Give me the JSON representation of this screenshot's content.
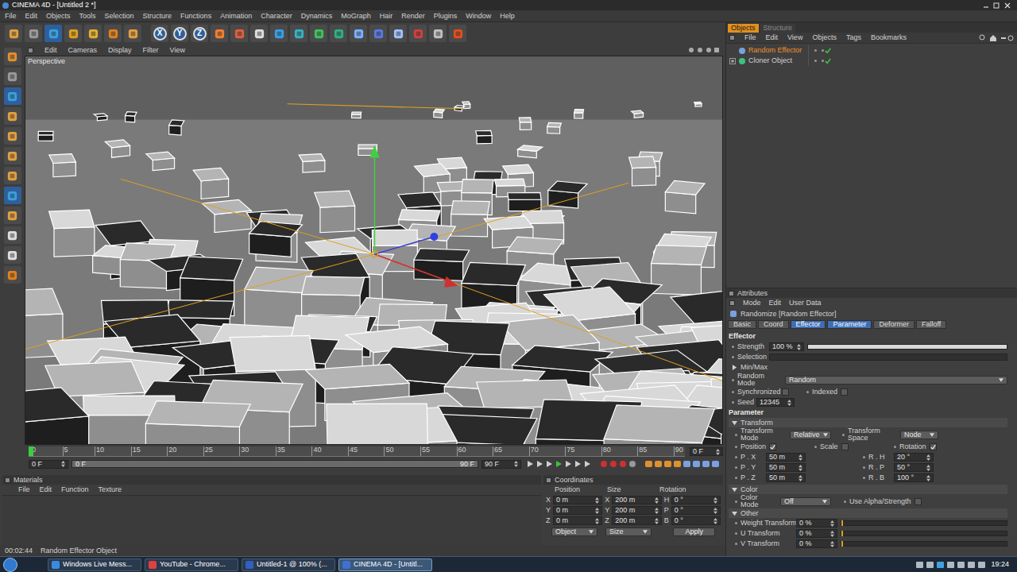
{
  "window": {
    "title": "CINEMA 4D - [Untitled 2 *]"
  },
  "menu": [
    "File",
    "Edit",
    "Objects",
    "Tools",
    "Selection",
    "Structure",
    "Functions",
    "Animation",
    "Character",
    "Dynamics",
    "MoGraph",
    "Hair",
    "Render",
    "Plugins",
    "Window",
    "Help"
  ],
  "toolbar": {
    "axis_buttons": [
      "X",
      "Y",
      "Z"
    ]
  },
  "viewport": {
    "menu": [
      "Edit",
      "Cameras",
      "Display",
      "Filter",
      "View"
    ],
    "label": "Perspective"
  },
  "timeline": {
    "ticks": [
      "0",
      "5",
      "10",
      "15",
      "20",
      "25",
      "30",
      "35",
      "40",
      "45",
      "50",
      "55",
      "60",
      "65",
      "70",
      "75",
      "80",
      "85",
      "90"
    ],
    "playhead": 0,
    "frame_field": "0 F",
    "start_field": "0 F",
    "range_start": "0 F",
    "range_end": "90 F",
    "end_field": "90 F"
  },
  "materials": {
    "title": "Materials",
    "menu": [
      "File",
      "Edit",
      "Function",
      "Texture"
    ]
  },
  "coordinates": {
    "title": "Coordinates",
    "headers": [
      "Position",
      "Size",
      "Rotation"
    ],
    "rows": [
      {
        "pos_axis": "X",
        "pos": "0 m",
        "size_axis": "X",
        "size": "200 m",
        "rot_axis": "H",
        "rot": "0 °"
      },
      {
        "pos_axis": "Y",
        "pos": "0 m",
        "size_axis": "Y",
        "size": "200 m",
        "rot_axis": "P",
        "rot": "0 °"
      },
      {
        "pos_axis": "Z",
        "pos": "0 m",
        "size_axis": "Z",
        "size": "200 m",
        "rot_axis": "B",
        "rot": "0 °"
      }
    ],
    "mode": "Object",
    "size_mode": "Size",
    "apply": "Apply"
  },
  "status_bar": {
    "time": "00:02:44",
    "message": "Random Effector Object"
  },
  "objects_panel": {
    "tabs": [
      {
        "label": "Objects",
        "selected": true
      },
      {
        "label": "Structure",
        "selected": false
      }
    ],
    "menu": [
      "File",
      "Edit",
      "View",
      "Objects",
      "Tags",
      "Bookmarks"
    ],
    "items": [
      {
        "name": "Random Effector",
        "selected": true,
        "expandable": false,
        "enabled": true
      },
      {
        "name": "Cloner Object",
        "selected": false,
        "expandable": true,
        "enabled": true
      }
    ]
  },
  "attributes": {
    "title": "Attributes",
    "menu": [
      "Mode",
      "Edit",
      "User Data"
    ],
    "object_name": "Randomize [Random Effector]",
    "tabs": [
      {
        "label": "Basic",
        "selected": false
      },
      {
        "label": "Coord",
        "selected": false
      },
      {
        "label": "Effector",
        "selected": true
      },
      {
        "label": "Parameter",
        "selected": true
      },
      {
        "label": "Deformer",
        "selected": false
      },
      {
        "label": "Falloff",
        "selected": false
      }
    ],
    "effector": {
      "heading": "Effector",
      "strength_label": "Strength",
      "strength": "100 %",
      "strength_level": 1,
      "selection_label": "Selection",
      "minmax": {
        "label": "Min/Max",
        "expanded": false
      },
      "random_mode_label": "Random Mode",
      "random_mode": "Random",
      "synchronized": {
        "label": "Synchronized",
        "checked": false
      },
      "indexed": {
        "label": "Indexed",
        "checked": false
      },
      "seed_label": "Seed",
      "seed": "12345"
    },
    "parameter": {
      "heading": "Parameter",
      "transform": {
        "label": "Transform",
        "expanded": true,
        "mode_label": "Transform Mode",
        "mode": "Relative",
        "space_label": "Transform Space",
        "space": "Node",
        "toggles": [
          {
            "label": "Position",
            "checked": true
          },
          {
            "label": "Scale",
            "checked": false
          },
          {
            "label": "Rotation",
            "checked": true
          }
        ],
        "position": [
          {
            "label": "P . X",
            "value": "50 m"
          },
          {
            "label": "P . Y",
            "value": "50 m"
          },
          {
            "label": "P . Z",
            "value": "50 m"
          }
        ],
        "rotation": [
          {
            "label": "R . H",
            "value": "20 °"
          },
          {
            "label": "R . P",
            "value": "50 °"
          },
          {
            "label": "R . B",
            "value": "100 °"
          }
        ]
      },
      "color": {
        "label": "Color",
        "expanded": true,
        "mode_label": "Color Mode",
        "mode": "Off",
        "alpha": {
          "label": "Use Alpha/Strength",
          "checked": false
        }
      },
      "other": {
        "label": "Other",
        "expanded": true,
        "rows": [
          {
            "label": "Weight Transform",
            "value": "0 %",
            "level": 0
          },
          {
            "label": "U Transform",
            "value": "0 %",
            "level": 0
          },
          {
            "label": "V Transform",
            "value": "0 %",
            "level": 0
          }
        ]
      }
    }
  },
  "taskbar": {
    "items": [
      {
        "label": "Windows Live Mess...",
        "selected": false
      },
      {
        "label": "YouTube - Chrome...",
        "selected": false
      },
      {
        "label": "Untitled-1 @ 100% (...",
        "selected": false
      },
      {
        "label": "CINEMA 4D - [Untitl...",
        "selected": true
      }
    ],
    "clock": "19:24"
  }
}
